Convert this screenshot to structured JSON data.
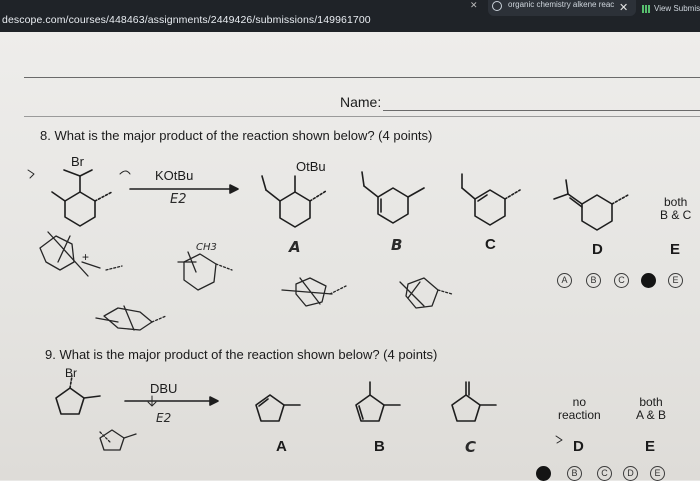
{
  "browser": {
    "url": "descope.com/courses/448463/assignments/2449426/submissions/149961700",
    "tab_title": "organic chemistry alkene reac",
    "tab_close": "✕",
    "view_submission": "View Submissio",
    "x_glyph": "✕"
  },
  "form": {
    "name_label": "Name:"
  },
  "question8": {
    "text": "8. What is the major product of the reaction shown below? (4 points)",
    "reactant_label": "Br",
    "reagent": "KOtBu",
    "condition": "E2",
    "product_label_otbu": "OtBu",
    "options": [
      {
        "letter": "A",
        "desc": ""
      },
      {
        "letter": "B",
        "desc": ""
      },
      {
        "letter": "C",
        "desc": ""
      },
      {
        "letter": "D",
        "desc": ""
      },
      {
        "letter": "E",
        "desc": "both B & C"
      }
    ],
    "option_e_line1": "both",
    "option_e_line2": "B & C",
    "handwriting_ch3": "CH3",
    "handwriting_plus": "+",
    "choices": [
      "A",
      "B",
      "C",
      "",
      "E"
    ],
    "selected": "D"
  },
  "question9": {
    "text": "9. What is the major product of the reaction shown below? (4 points)",
    "reactant_label": "Br",
    "reagent": "DBU",
    "condition": "E2",
    "option_d_line1": "no",
    "option_d_line2": "reaction",
    "option_e_line1": "both",
    "option_e_line2": "A & B",
    "letters": [
      "A",
      "B",
      "C",
      "D",
      "E"
    ],
    "choices": [
      "",
      "B",
      "C",
      "D",
      "E"
    ],
    "selected": "A"
  }
}
